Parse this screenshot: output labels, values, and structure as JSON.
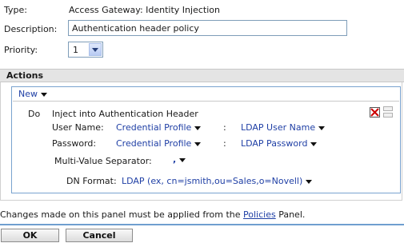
{
  "form": {
    "type_label": "Type:",
    "type_value": "Access Gateway: Identity Injection",
    "description_label": "Description:",
    "description_value": "Authentication header policy",
    "priority_label": "Priority:",
    "priority_value": "1"
  },
  "actions": {
    "header": "Actions",
    "new_menu": "New",
    "do_label": "Do",
    "action_title": "Inject into Authentication Header",
    "username_label": "User Name:",
    "username_source": "Credential Profile",
    "colon": ":",
    "username_value": "LDAP User Name",
    "password_label": "Password:",
    "password_source": "Credential Profile",
    "password_value": "LDAP Password",
    "multivalue_label": "Multi-Value Separator:",
    "multivalue_value": ",",
    "dn_format_label": "DN Format:",
    "dn_format_value": "LDAP (ex, cn=jsmith,ou=Sales,o=Novell)"
  },
  "footer": {
    "note_prefix": "Changes made on this panel must be applied from the",
    "note_link": "Policies",
    "note_suffix": "Panel.",
    "ok_label": "OK",
    "cancel_label": "Cancel"
  },
  "colors": {
    "link_blue": "#1f3fa5",
    "delete_red": "#cc0000",
    "panel_border": "#7aa3cf"
  }
}
